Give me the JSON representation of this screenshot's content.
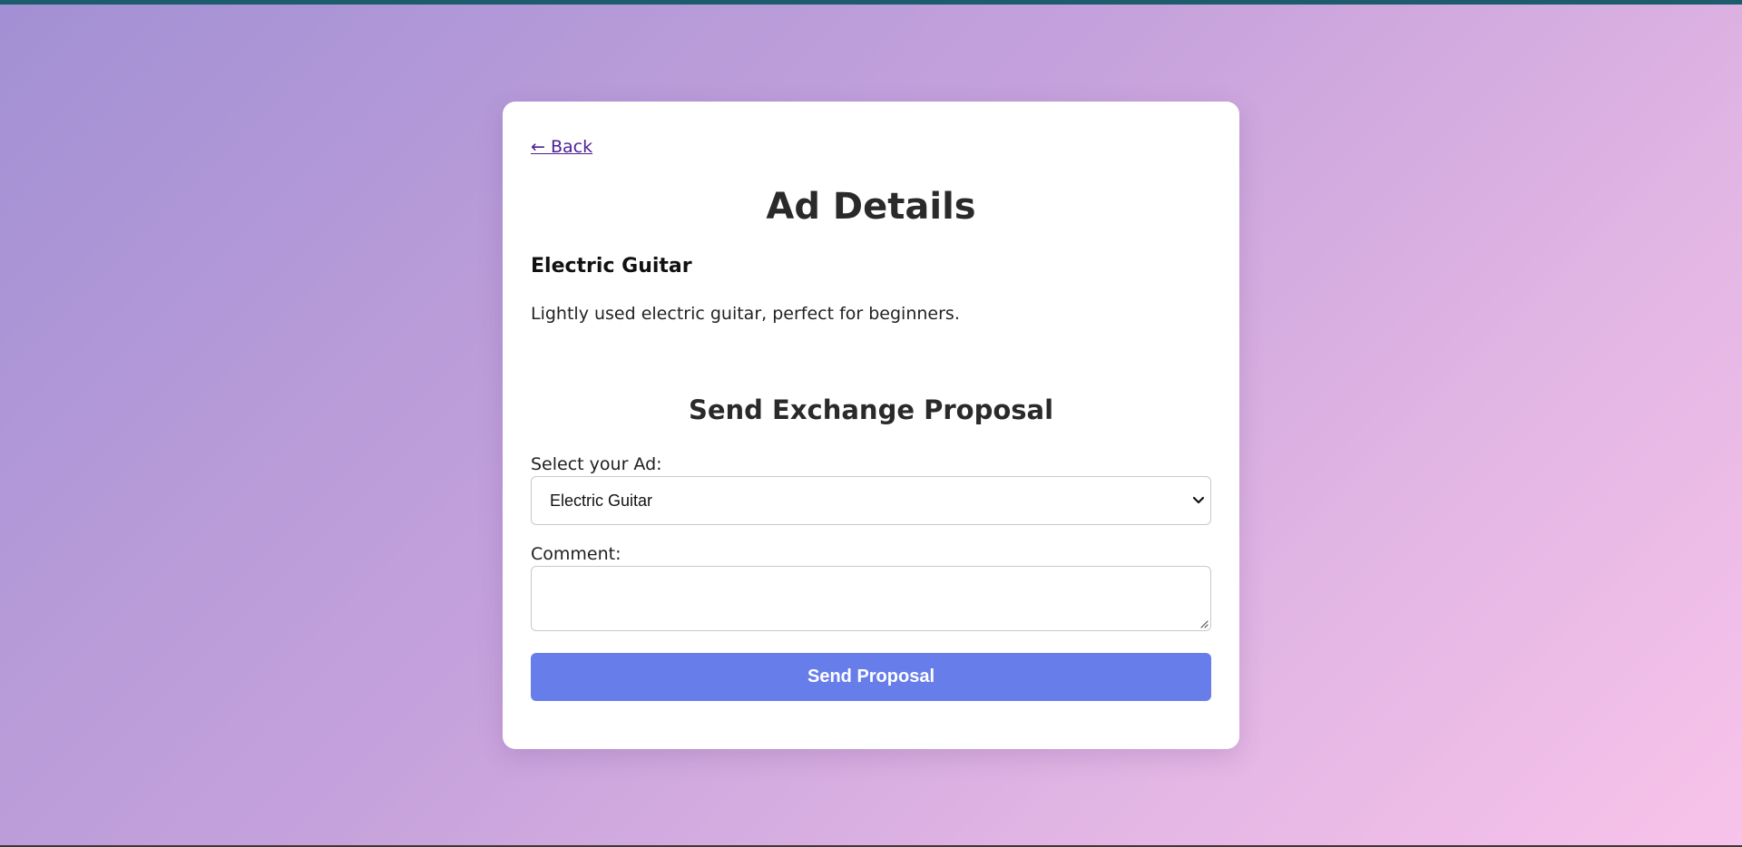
{
  "nav": {
    "back_label": "← Back"
  },
  "page": {
    "title": "Ad Details"
  },
  "ad": {
    "title": "Electric Guitar",
    "description": "Lightly used electric guitar, perfect for beginners."
  },
  "proposal": {
    "heading": "Send Exchange Proposal",
    "select_label": "Select your Ad:",
    "selected_ad": "Electric Guitar",
    "comment_label": "Comment:",
    "comment_value": "",
    "submit_label": "Send Proposal"
  },
  "colors": {
    "accent": "#677eea",
    "link": "#4b1f96",
    "top_bar": "#1c5c6c"
  },
  "icons": {
    "select_arrow": "chevron-down-icon",
    "textarea_resize": "resize-handle-icon"
  }
}
